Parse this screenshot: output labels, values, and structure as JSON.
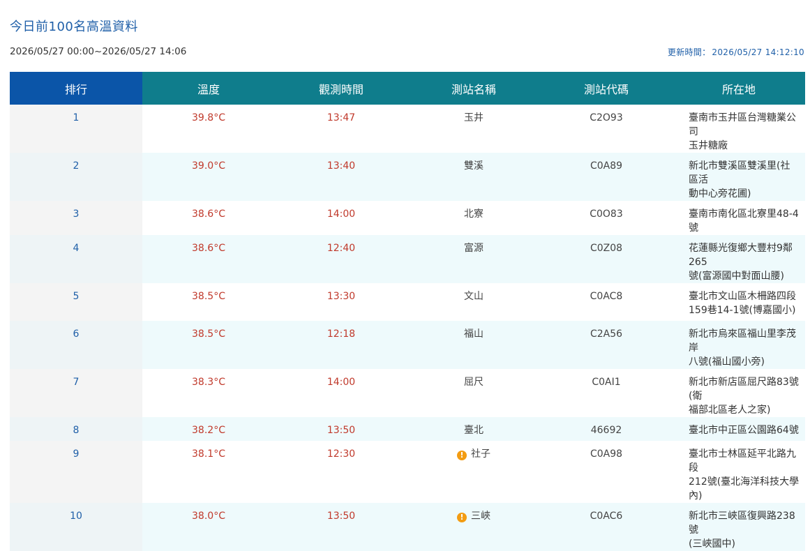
{
  "header": {
    "title": "今日前100名高溫資料",
    "range": "2026/05/27 00:00~2026/05/27 14:06",
    "updated_label": "更新時間：",
    "updated_value": "2026/05/27 14:12:10"
  },
  "table": {
    "columns": [
      "排行",
      "溫度",
      "觀測時間",
      "測站名稱",
      "測站代碼",
      "所在地"
    ],
    "rows": [
      {
        "rank": "1",
        "temp": "39.8°C",
        "time": "13:47",
        "name": "玉井",
        "warn": false,
        "code": "C2O93",
        "loc1": "臺南市玉井區台灣糖業公司",
        "loc2": "玉井糖廠"
      },
      {
        "rank": "2",
        "temp": "39.0°C",
        "time": "13:40",
        "name": "雙溪",
        "warn": false,
        "code": "C0A89",
        "loc1": "新北市雙溪區雙溪里(社區活",
        "loc2": "動中心旁花圃)"
      },
      {
        "rank": "3",
        "temp": "38.6°C",
        "time": "14:00",
        "name": "北寮",
        "warn": false,
        "code": "C0O83",
        "loc1": "臺南市南化區北寮里48-4號",
        "loc2": ""
      },
      {
        "rank": "4",
        "temp": "38.6°C",
        "time": "12:40",
        "name": "富源",
        "warn": false,
        "code": "C0Z08",
        "loc1": "花蓮縣光復鄉大豐村9鄰265",
        "loc2": "號(富源國中對面山腰)"
      },
      {
        "rank": "5",
        "temp": "38.5°C",
        "time": "13:30",
        "name": "文山",
        "warn": false,
        "code": "C0AC8",
        "loc1": "臺北市文山區木柵路四段",
        "loc2": "159巷14-1號(博嘉國小)"
      },
      {
        "rank": "6",
        "temp": "38.5°C",
        "time": "12:18",
        "name": "福山",
        "warn": false,
        "code": "C2A56",
        "loc1": "新北市烏來區福山里李茂岸",
        "loc2": "八號(福山國小旁)"
      },
      {
        "rank": "7",
        "temp": "38.3°C",
        "time": "14:00",
        "name": "屈尺",
        "warn": false,
        "code": "C0AI1",
        "loc1": "新北市新店區屈尺路83號(衛",
        "loc2": "福部北區老人之家)"
      },
      {
        "rank": "8",
        "temp": "38.2°C",
        "time": "13:50",
        "name": "臺北",
        "warn": false,
        "code": "46692",
        "loc1": "臺北市中正區公園路64號",
        "loc2": ""
      },
      {
        "rank": "9",
        "temp": "38.1°C",
        "time": "12:30",
        "name": "社子",
        "warn": true,
        "code": "C0A98",
        "loc1": "臺北市士林區延平北路九段",
        "loc2": "212號(臺北海洋科技大學內)"
      },
      {
        "rank": "10",
        "temp": "38.0°C",
        "time": "13:50",
        "name": "三峽",
        "warn": true,
        "code": "C0AC6",
        "loc1": "新北市三峽區復興路238號",
        "loc2": "(三峽國中)"
      }
    ]
  },
  "icons": {
    "warning": "exclamation-circle-icon",
    "warning_color": "#f39c12"
  },
  "colors": {
    "header_bg": "#0f7d8c",
    "rank_header_bg": "#0b55a8",
    "temp_text": "#c0392b",
    "title_text": "#1f5fa8"
  }
}
